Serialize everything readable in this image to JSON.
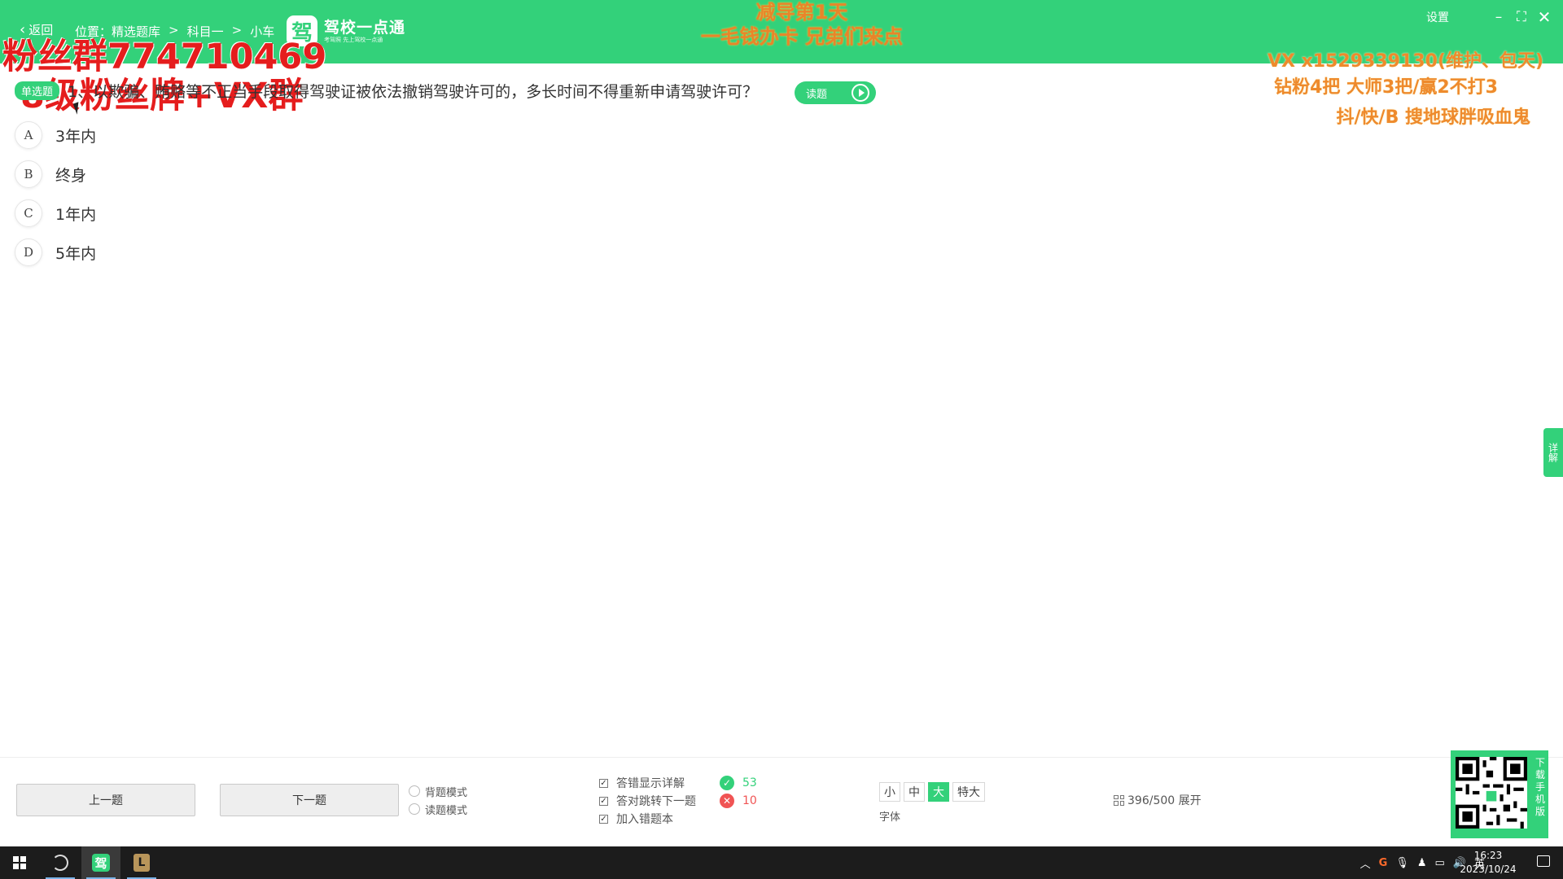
{
  "header": {
    "back_label": "返回",
    "breadcrumb": [
      "位置：精选题库",
      "科目一",
      "小车"
    ],
    "breadcrumb_sep": ">",
    "logo_char": "驾",
    "logo_title": "驾校一点通",
    "logo_sub": "考驾照 先上驾校一点通",
    "settings_label": "设置",
    "overlay_line1": "减导第1天",
    "overlay_line2": "一毛钱办卡 兄弟们来点"
  },
  "watermarks": {
    "left_line1": "粉丝群774710469",
    "left_line2": "8级粉丝牌+VX群",
    "right_line1": "VX x1529339130(维护、包天)",
    "right_line2": "钻粉4把 大师3把/赢2不打3",
    "right_line3": "抖/快/B 搜地球胖吸血鬼"
  },
  "question": {
    "type_badge": "单选题",
    "text": "1、以欺骗、贿赂等不正当手段取得驾驶证被依法撤销驾驶许可的，多长时间不得重新申请驾驶许可？",
    "read_label": "读题"
  },
  "options": [
    {
      "letter": "A",
      "text": "3年内"
    },
    {
      "letter": "B",
      "text": "终身"
    },
    {
      "letter": "C",
      "text": "1年内"
    },
    {
      "letter": "D",
      "text": "5年内"
    }
  ],
  "side_tab": "详解",
  "bottom": {
    "prev_label": "上一题",
    "next_label": "下一题",
    "modes": [
      "背题模式",
      "读题模式"
    ],
    "checks": [
      "答错显示详解",
      "答对跳转下一题",
      "加入错题本"
    ],
    "correct_count": "53",
    "wrong_count": "10",
    "font_sizes": [
      "小",
      "中",
      "大",
      "特大"
    ],
    "font_active": "大",
    "font_label": "字体",
    "progress_text": "396/500 展开",
    "qr_label": "下载手机版"
  },
  "taskbar": {
    "time": "16:23",
    "date": "2023/10/24",
    "ime": "英"
  },
  "colors": {
    "brand_green": "#33d17a",
    "watermark_red": "#e51d1d",
    "watermark_orange": "#ee8a2c",
    "wrong_red": "#f05454"
  }
}
